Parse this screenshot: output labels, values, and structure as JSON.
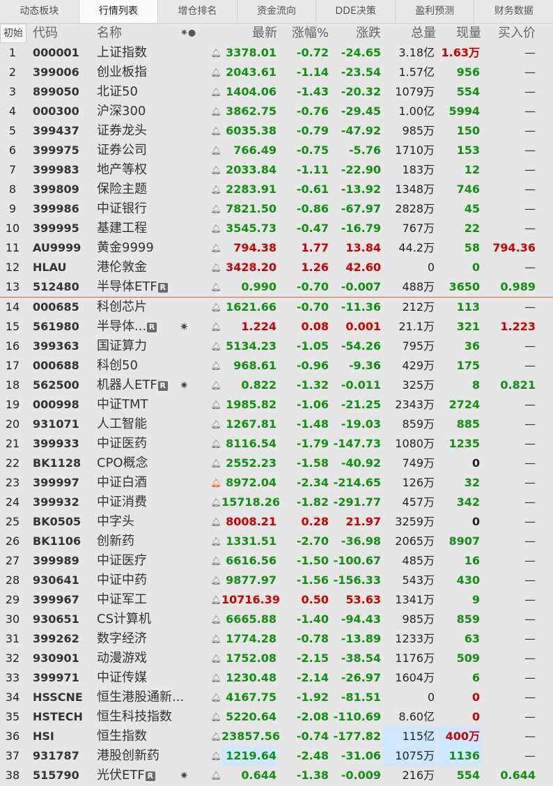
{
  "tabs": [
    "动态板块",
    "行情列表",
    "增仓排名",
    "资金流向",
    "DDE决策",
    "盈利预测",
    "财务数据"
  ],
  "active_tab": 1,
  "header": {
    "init": "初始",
    "code": "代码",
    "name": "名称",
    "flags": "✷●",
    "last": "最新",
    "pct": "涨幅%",
    "chg": "涨跌",
    "vol": "总量",
    "cur": "现量",
    "bid": "买入价"
  },
  "colors": {
    "up": "#cc0000",
    "down": "#109010",
    "highlight": "#cfe8ff",
    "divider": "#d65a28",
    "alert_bell": "#ff4a12"
  },
  "rows": [
    {
      "idx": "1",
      "code": "000001",
      "name": "上证指数",
      "last": "3378.01",
      "pct": "-0.72",
      "chg": "-24.65",
      "vol": "3.18亿",
      "cur": "1.63万",
      "bid": "—"
    },
    {
      "idx": "2",
      "code": "399006",
      "name": "创业板指",
      "last": "2043.61",
      "pct": "-1.14",
      "chg": "-23.54",
      "vol": "1.57亿",
      "cur": "956",
      "bid": "—"
    },
    {
      "idx": "3",
      "code": "899050",
      "name": "北证50",
      "last": "1404.06",
      "pct": "-1.43",
      "chg": "-20.32",
      "vol": "1079万",
      "cur": "554",
      "bid": "—"
    },
    {
      "idx": "4",
      "code": "000300",
      "name": "沪深300",
      "last": "3862.75",
      "pct": "-0.76",
      "chg": "-29.45",
      "vol": "1.00亿",
      "cur": "5994",
      "bid": "—"
    },
    {
      "idx": "5",
      "code": "399437",
      "name": "证券龙头",
      "last": "6035.38",
      "pct": "-0.79",
      "chg": "-47.92",
      "vol": "985万",
      "cur": "150",
      "bid": "—"
    },
    {
      "idx": "6",
      "code": "399975",
      "name": "证券公司",
      "last": "766.49",
      "pct": "-0.75",
      "chg": "-5.76",
      "vol": "1710万",
      "cur": "153",
      "bid": "—"
    },
    {
      "idx": "7",
      "code": "399983",
      "name": "地产等权",
      "last": "2033.84",
      "pct": "-1.11",
      "chg": "-22.90",
      "vol": "183万",
      "cur": "12",
      "bid": "—"
    },
    {
      "idx": "8",
      "code": "399809",
      "name": "保险主题",
      "last": "2283.91",
      "pct": "-0.61",
      "chg": "-13.92",
      "vol": "1348万",
      "cur": "746",
      "bid": "—"
    },
    {
      "idx": "9",
      "code": "399986",
      "name": "中证银行",
      "last": "7821.50",
      "pct": "-0.86",
      "chg": "-67.97",
      "vol": "2828万",
      "cur": "45",
      "bid": "—"
    },
    {
      "idx": "10",
      "code": "399995",
      "name": "基建工程",
      "last": "3545.73",
      "pct": "-0.47",
      "chg": "-16.79",
      "vol": "767万",
      "cur": "22",
      "bid": "—"
    },
    {
      "idx": "11",
      "code": "AU9999",
      "name": "黄金9999",
      "last": "794.38",
      "pct": "1.77",
      "chg": "13.84",
      "vol": "44.2万",
      "cur": "58",
      "bid": "794.36"
    },
    {
      "idx": "12",
      "code": "HLAU",
      "name": "港伦敦金",
      "last": "3428.20",
      "pct": "1.26",
      "chg": "42.60",
      "vol": "0",
      "cur": "0",
      "bid": "—"
    },
    {
      "idx": "13",
      "code": "512480",
      "name": "半导体ETF",
      "badge": "R",
      "last": "0.990",
      "pct": "-0.70",
      "chg": "-0.007",
      "vol": "488万",
      "cur": "3650",
      "bid": "0.989"
    },
    {
      "idx": "14",
      "code": "000685",
      "name": "科创芯片",
      "last": "1621.66",
      "pct": "-0.70",
      "chg": "-11.36",
      "vol": "212万",
      "cur": "113",
      "bid": "—"
    },
    {
      "idx": "15",
      "code": "561980",
      "name": "半导体...",
      "badge": "R",
      "star": "✷",
      "last": "1.224",
      "pct": "0.08",
      "chg": "0.001",
      "vol": "21.1万",
      "cur": "321",
      "bid": "1.223"
    },
    {
      "idx": "16",
      "code": "399363",
      "name": "国证算力",
      "last": "5134.23",
      "pct": "-1.05",
      "chg": "-54.26",
      "vol": "795万",
      "cur": "36",
      "bid": "—"
    },
    {
      "idx": "17",
      "code": "000688",
      "name": "科创50",
      "last": "968.61",
      "pct": "-0.96",
      "chg": "-9.36",
      "vol": "429万",
      "cur": "175",
      "bid": "—"
    },
    {
      "idx": "18",
      "code": "562500",
      "name": "机器人ETF",
      "badge": "R",
      "star": "✷",
      "last": "0.822",
      "pct": "-1.32",
      "chg": "-0.011",
      "vol": "325万",
      "cur": "8",
      "bid": "0.821"
    },
    {
      "idx": "19",
      "code": "000998",
      "name": "中证TMT",
      "last": "1985.82",
      "pct": "-1.06",
      "chg": "-21.25",
      "vol": "2343万",
      "cur": "2724",
      "bid": "—"
    },
    {
      "idx": "20",
      "code": "931071",
      "name": "人工智能",
      "last": "1267.81",
      "pct": "-1.48",
      "chg": "-19.03",
      "vol": "859万",
      "cur": "885",
      "bid": "—"
    },
    {
      "idx": "21",
      "code": "399933",
      "name": "中证医药",
      "last": "8116.54",
      "pct": "-1.79",
      "chg": "-147.73",
      "vol": "1080万",
      "cur": "1235",
      "bid": "—"
    },
    {
      "idx": "22",
      "code": "BK1128",
      "name": "CPO概念",
      "last": "2552.23",
      "pct": "-1.58",
      "chg": "-40.92",
      "vol": "749万",
      "cur": "0",
      "bid": "—"
    },
    {
      "idx": "23",
      "code": "399997",
      "name": "中证白酒",
      "bell_alert": true,
      "last": "8972.04",
      "pct": "-2.34",
      "chg": "-214.65",
      "vol": "126万",
      "cur": "32",
      "bid": "—"
    },
    {
      "idx": "24",
      "code": "399932",
      "name": "中证消费",
      "last": "15718.26",
      "pct": "-1.82",
      "chg": "-291.77",
      "vol": "457万",
      "cur": "342",
      "bid": "—"
    },
    {
      "idx": "25",
      "code": "BK0505",
      "name": "中字头",
      "last": "8008.21",
      "pct": "0.28",
      "chg": "21.97",
      "vol": "3259万",
      "cur": "0",
      "bid": "—"
    },
    {
      "idx": "26",
      "code": "BK1106",
      "name": "创新药",
      "last": "1331.51",
      "pct": "-2.70",
      "chg": "-36.98",
      "vol": "2065万",
      "cur": "8907",
      "bid": "—"
    },
    {
      "idx": "27",
      "code": "399989",
      "name": "中证医疗",
      "last": "6616.56",
      "pct": "-1.50",
      "chg": "-100.67",
      "vol": "485万",
      "cur": "16",
      "bid": "—"
    },
    {
      "idx": "28",
      "code": "930641",
      "name": "中证中药",
      "last": "9877.97",
      "pct": "-1.56",
      "chg": "-156.33",
      "vol": "543万",
      "cur": "430",
      "bid": "—"
    },
    {
      "idx": "29",
      "code": "399967",
      "name": "中证军工",
      "last": "10716.39",
      "pct": "0.50",
      "chg": "53.63",
      "vol": "1341万",
      "cur": "9",
      "bid": "—"
    },
    {
      "idx": "30",
      "code": "930651",
      "name": "CS计算机",
      "last": "6665.88",
      "pct": "-1.40",
      "chg": "-94.43",
      "vol": "985万",
      "cur": "859",
      "bid": "—"
    },
    {
      "idx": "31",
      "code": "399262",
      "name": "数字经济",
      "last": "1774.28",
      "pct": "-0.78",
      "chg": "-13.89",
      "vol": "1233万",
      "cur": "63",
      "bid": "—"
    },
    {
      "idx": "32",
      "code": "930901",
      "name": "动漫游戏",
      "last": "1752.08",
      "pct": "-2.15",
      "chg": "-38.54",
      "vol": "1176万",
      "cur": "509",
      "bid": "—"
    },
    {
      "idx": "33",
      "code": "399971",
      "name": "中证传媒",
      "last": "1230.48",
      "pct": "-2.14",
      "chg": "-26.97",
      "vol": "1604万",
      "cur": "6",
      "bid": "—"
    },
    {
      "idx": "34",
      "code": "HSSCNE",
      "name": "恒生港股通新...",
      "last": "4167.75",
      "pct": "-1.92",
      "chg": "-81.51",
      "vol": "0",
      "cur": "0",
      "bid": "—"
    },
    {
      "idx": "35",
      "code": "HSTECH",
      "name": "恒生科技指数",
      "last": "5220.64",
      "pct": "-2.08",
      "chg": "-110.69",
      "vol": "8.60亿",
      "cur": "0",
      "bid": "—"
    },
    {
      "idx": "36",
      "code": "HSI",
      "name": "恒生指数",
      "last": "23857.56",
      "pct": "-0.74",
      "chg": "-177.82",
      "vol": "115亿",
      "cur": "400万",
      "bid": "—"
    },
    {
      "idx": "37",
      "code": "931787",
      "name": "港股创新药",
      "last": "1219.64",
      "pct": "-2.48",
      "chg": "-31.06",
      "vol": "1075万",
      "cur": "1136",
      "bid": "—"
    },
    {
      "idx": "38",
      "code": "515790",
      "name": "光伏ETF",
      "badge": "R",
      "star": "✷",
      "last": "0.644",
      "pct": "-1.38",
      "chg": "-0.009",
      "vol": "216万",
      "cur": "554",
      "bid": "0.644"
    }
  ]
}
